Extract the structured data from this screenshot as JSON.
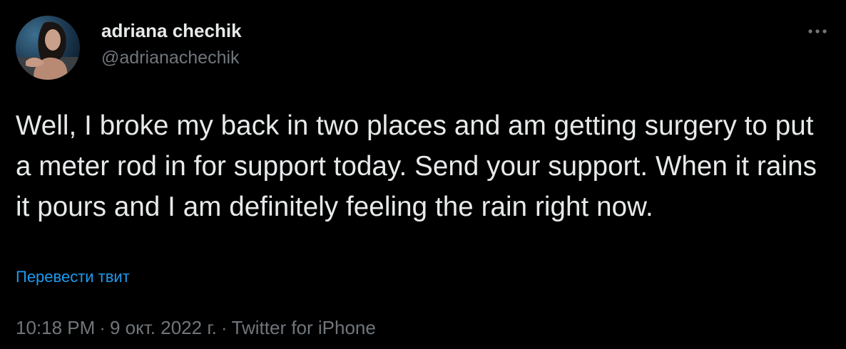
{
  "colors": {
    "background": "#000000",
    "text_primary": "#e7e9ea",
    "text_secondary": "#71767b",
    "link": "#1d9bf0"
  },
  "author": {
    "display_name": "adriana chechik",
    "handle": "@adrianachechik",
    "avatar_icon": "profile-avatar"
  },
  "more_button_icon": "more-horizontal-icon",
  "tweet": {
    "text": "Well, I broke my back in two places and am getting surgery to put a meter rod in for support today. Send your support. When it rains it pours and I am definitely feeling the rain right now.",
    "translate_label": "Перевести твит"
  },
  "meta": {
    "time": "10:18 PM",
    "separator": "·",
    "date": "9 окт. 2022 г.",
    "source": "Twitter for iPhone"
  }
}
